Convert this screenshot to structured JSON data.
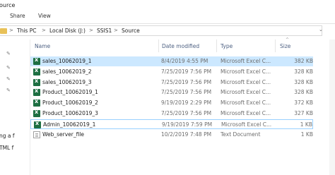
{
  "window": {
    "title": "ource"
  },
  "ribbon": {
    "tabs": [
      "Share",
      "View"
    ]
  },
  "address": {
    "crumbs": [
      "This PC",
      "Local Disk (J:)",
      "SSIS1",
      "Source"
    ],
    "separator": ">",
    "folder_icon": "folder-icon",
    "dropdown_glyph": "⌄"
  },
  "nav": {
    "pin_glyph": "✎",
    "texts": [
      "ng a f",
      "TML f"
    ]
  },
  "columns": {
    "name": "Name",
    "date": "Date modified",
    "type": "Type",
    "size": "Size",
    "sort_glyph": "^"
  },
  "files": [
    {
      "name": "sales_10062019_1",
      "date": "8/4/2019 4:55 PM",
      "type": "Microsoft Excel C...",
      "size": "382 KB",
      "icon": "excel-csv-icon",
      "state": "selected"
    },
    {
      "name": "sales_10062019_2",
      "date": "7/25/2019 7:56 PM",
      "type": "Microsoft Excel C...",
      "size": "328 KB",
      "icon": "excel-csv-icon",
      "state": "normal"
    },
    {
      "name": "sales_10062019_3",
      "date": "7/25/2019 7:56 PM",
      "type": "Microsoft Excel C...",
      "size": "328 KB",
      "icon": "excel-csv-icon",
      "state": "normal"
    },
    {
      "name": "Product_10062019_1",
      "date": "7/25/2019 7:56 PM",
      "type": "Microsoft Excel C...",
      "size": "328 KB",
      "icon": "excel-csv-icon",
      "state": "normal"
    },
    {
      "name": "Product_10062019_2",
      "date": "9/19/2019 2:29 PM",
      "type": "Microsoft Excel C...",
      "size": "372 KB",
      "icon": "excel-csv-icon",
      "state": "normal"
    },
    {
      "name": "Product_10062019_3",
      "date": "7/25/2019 7:56 PM",
      "type": "Microsoft Excel C...",
      "size": "327 KB",
      "icon": "excel-csv-icon",
      "state": "normal"
    },
    {
      "name": "Admin_10062019_1",
      "date": "9/19/2019 7:59 PM",
      "type": "Microsoft Excel C...",
      "size": "1 KB",
      "icon": "excel-csv-icon",
      "state": "focused"
    },
    {
      "name": "Web_server_file",
      "date": "10/2/2019 7:48 PM",
      "type": "Text Document",
      "size": "1 KB",
      "icon": "text-document-icon",
      "state": "normal"
    }
  ],
  "colors": {
    "selected_row": "#cce8ff",
    "focus_outline": "#99d1ff",
    "header_text": "#4d6082",
    "excel_green": "#1d6f42"
  }
}
